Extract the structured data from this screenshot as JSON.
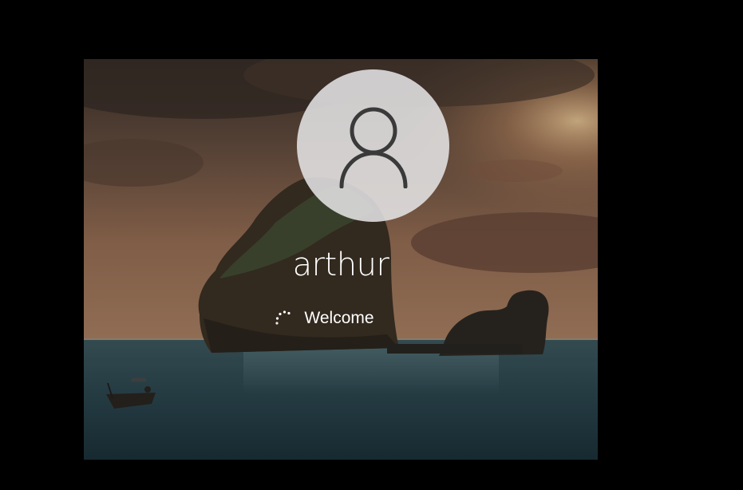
{
  "lock_screen": {
    "username": "arthur",
    "status_text": "Welcome"
  },
  "icons": {
    "avatar": "user-silhouette-icon",
    "spinner": "loading-spinner-icon"
  },
  "colors": {
    "outer_background": "#000000",
    "avatar_circle": "#e6e6e8",
    "avatar_glyph": "#3a3a3a",
    "text": "#ffffff"
  }
}
